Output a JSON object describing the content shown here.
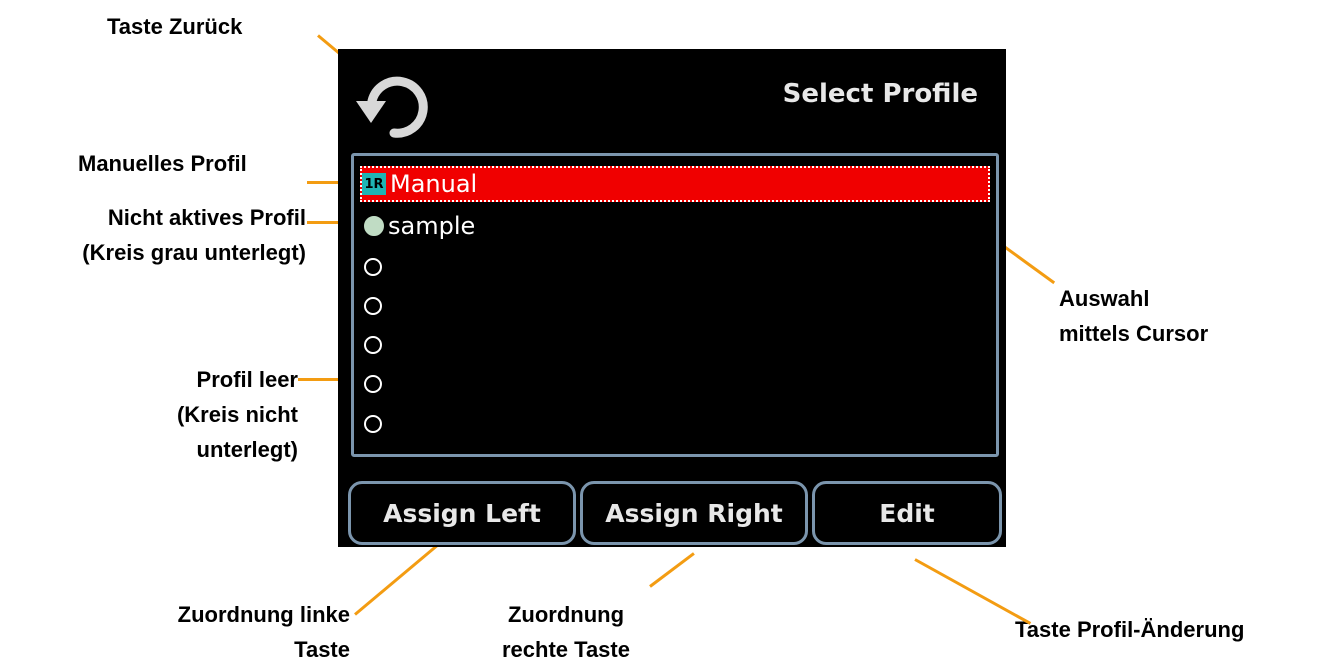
{
  "screen": {
    "title": "Select Profile",
    "profiles": [
      {
        "badge": "1R",
        "label": "Manual",
        "state": "manual-selected"
      },
      {
        "label": "sample",
        "state": "inactive"
      },
      {
        "label": "",
        "state": "empty"
      },
      {
        "label": "",
        "state": "empty"
      },
      {
        "label": "",
        "state": "empty"
      },
      {
        "label": "",
        "state": "empty"
      },
      {
        "label": "",
        "state": "empty"
      }
    ],
    "softkeys": {
      "assign_left": "Assign Left",
      "assign_right": "Assign Right",
      "edit": "Edit"
    },
    "colors": {
      "selection": "#f00000",
      "frame": "#7b95ad",
      "badge": "#1fb4b4",
      "inactive_circle": "#c0dcc4",
      "callout_line": "#f39c12"
    },
    "icons": {
      "back": "undo-arrow-icon"
    }
  },
  "annotations": {
    "back": "Taste Zurück",
    "manual": "Manuelles Profil",
    "inactive_1": "Nicht aktives Profil",
    "inactive_2": "(Kreis grau unterlegt)",
    "empty_1": "Profil leer",
    "empty_2": "(Kreis nicht",
    "empty_3": "unterlegt)",
    "cursor_1": "Auswahl",
    "cursor_2": "mittels Cursor",
    "left_1": "Zuordnung linke",
    "left_2": "Taste",
    "right_1": "Zuordnung",
    "right_2": "rechte Taste",
    "edit": "Taste Profil-Änderung"
  }
}
